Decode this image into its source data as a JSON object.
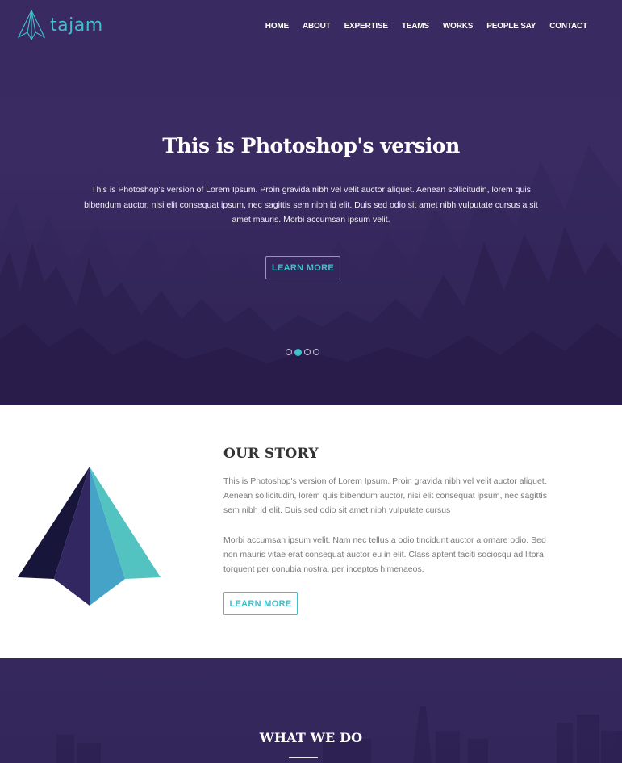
{
  "brand": {
    "name": "tajam",
    "accent": "#3fc1c9",
    "icon": "pyramid-logo-icon"
  },
  "nav": {
    "items": [
      {
        "label": "HOME"
      },
      {
        "label": "ABOUT"
      },
      {
        "label": "EXPERTISE"
      },
      {
        "label": "TEAMS"
      },
      {
        "label": "WORKS"
      },
      {
        "label": "PEOPLE SAY"
      },
      {
        "label": "CONTACT"
      }
    ]
  },
  "hero": {
    "title": "This is Photoshop's version",
    "text": "This is Photoshop's version of Lorem Ipsum. Proin gravida nibh vel velit auctor aliquet. Aenean sollicitudin, lorem quis bibendum auctor, nisi elit consequat ipsum, nec sagittis sem nibh id elit. Duis sed odio sit amet nibh vulputate cursus a sit amet mauris. Morbi accumsan ipsum velit.",
    "button": "LEARN MORE",
    "slides": 4,
    "active_slide": 2
  },
  "story": {
    "title": "OUR STORY",
    "p1": "This is Photoshop's version of Lorem Ipsum. Proin gravida nibh vel velit auctor aliquet. Aenean sollicitudin, lorem quis bibendum auctor, nisi elit consequat ipsum, nec sagittis sem nibh id elit. Duis sed odio sit amet nibh vulputate cursus",
    "p2": "Morbi accumsan ipsum velit. Nam nec tellus a odio tincidunt auctor a ornare odio. Sed non mauris vitae erat consequat auctor eu in elit. Class aptent taciti sociosqu ad litora torquent per conubia nostra, per inceptos himenaeos.",
    "button": "LEARN MORE"
  },
  "what_we_do": {
    "title": "WHAT WE DO"
  }
}
